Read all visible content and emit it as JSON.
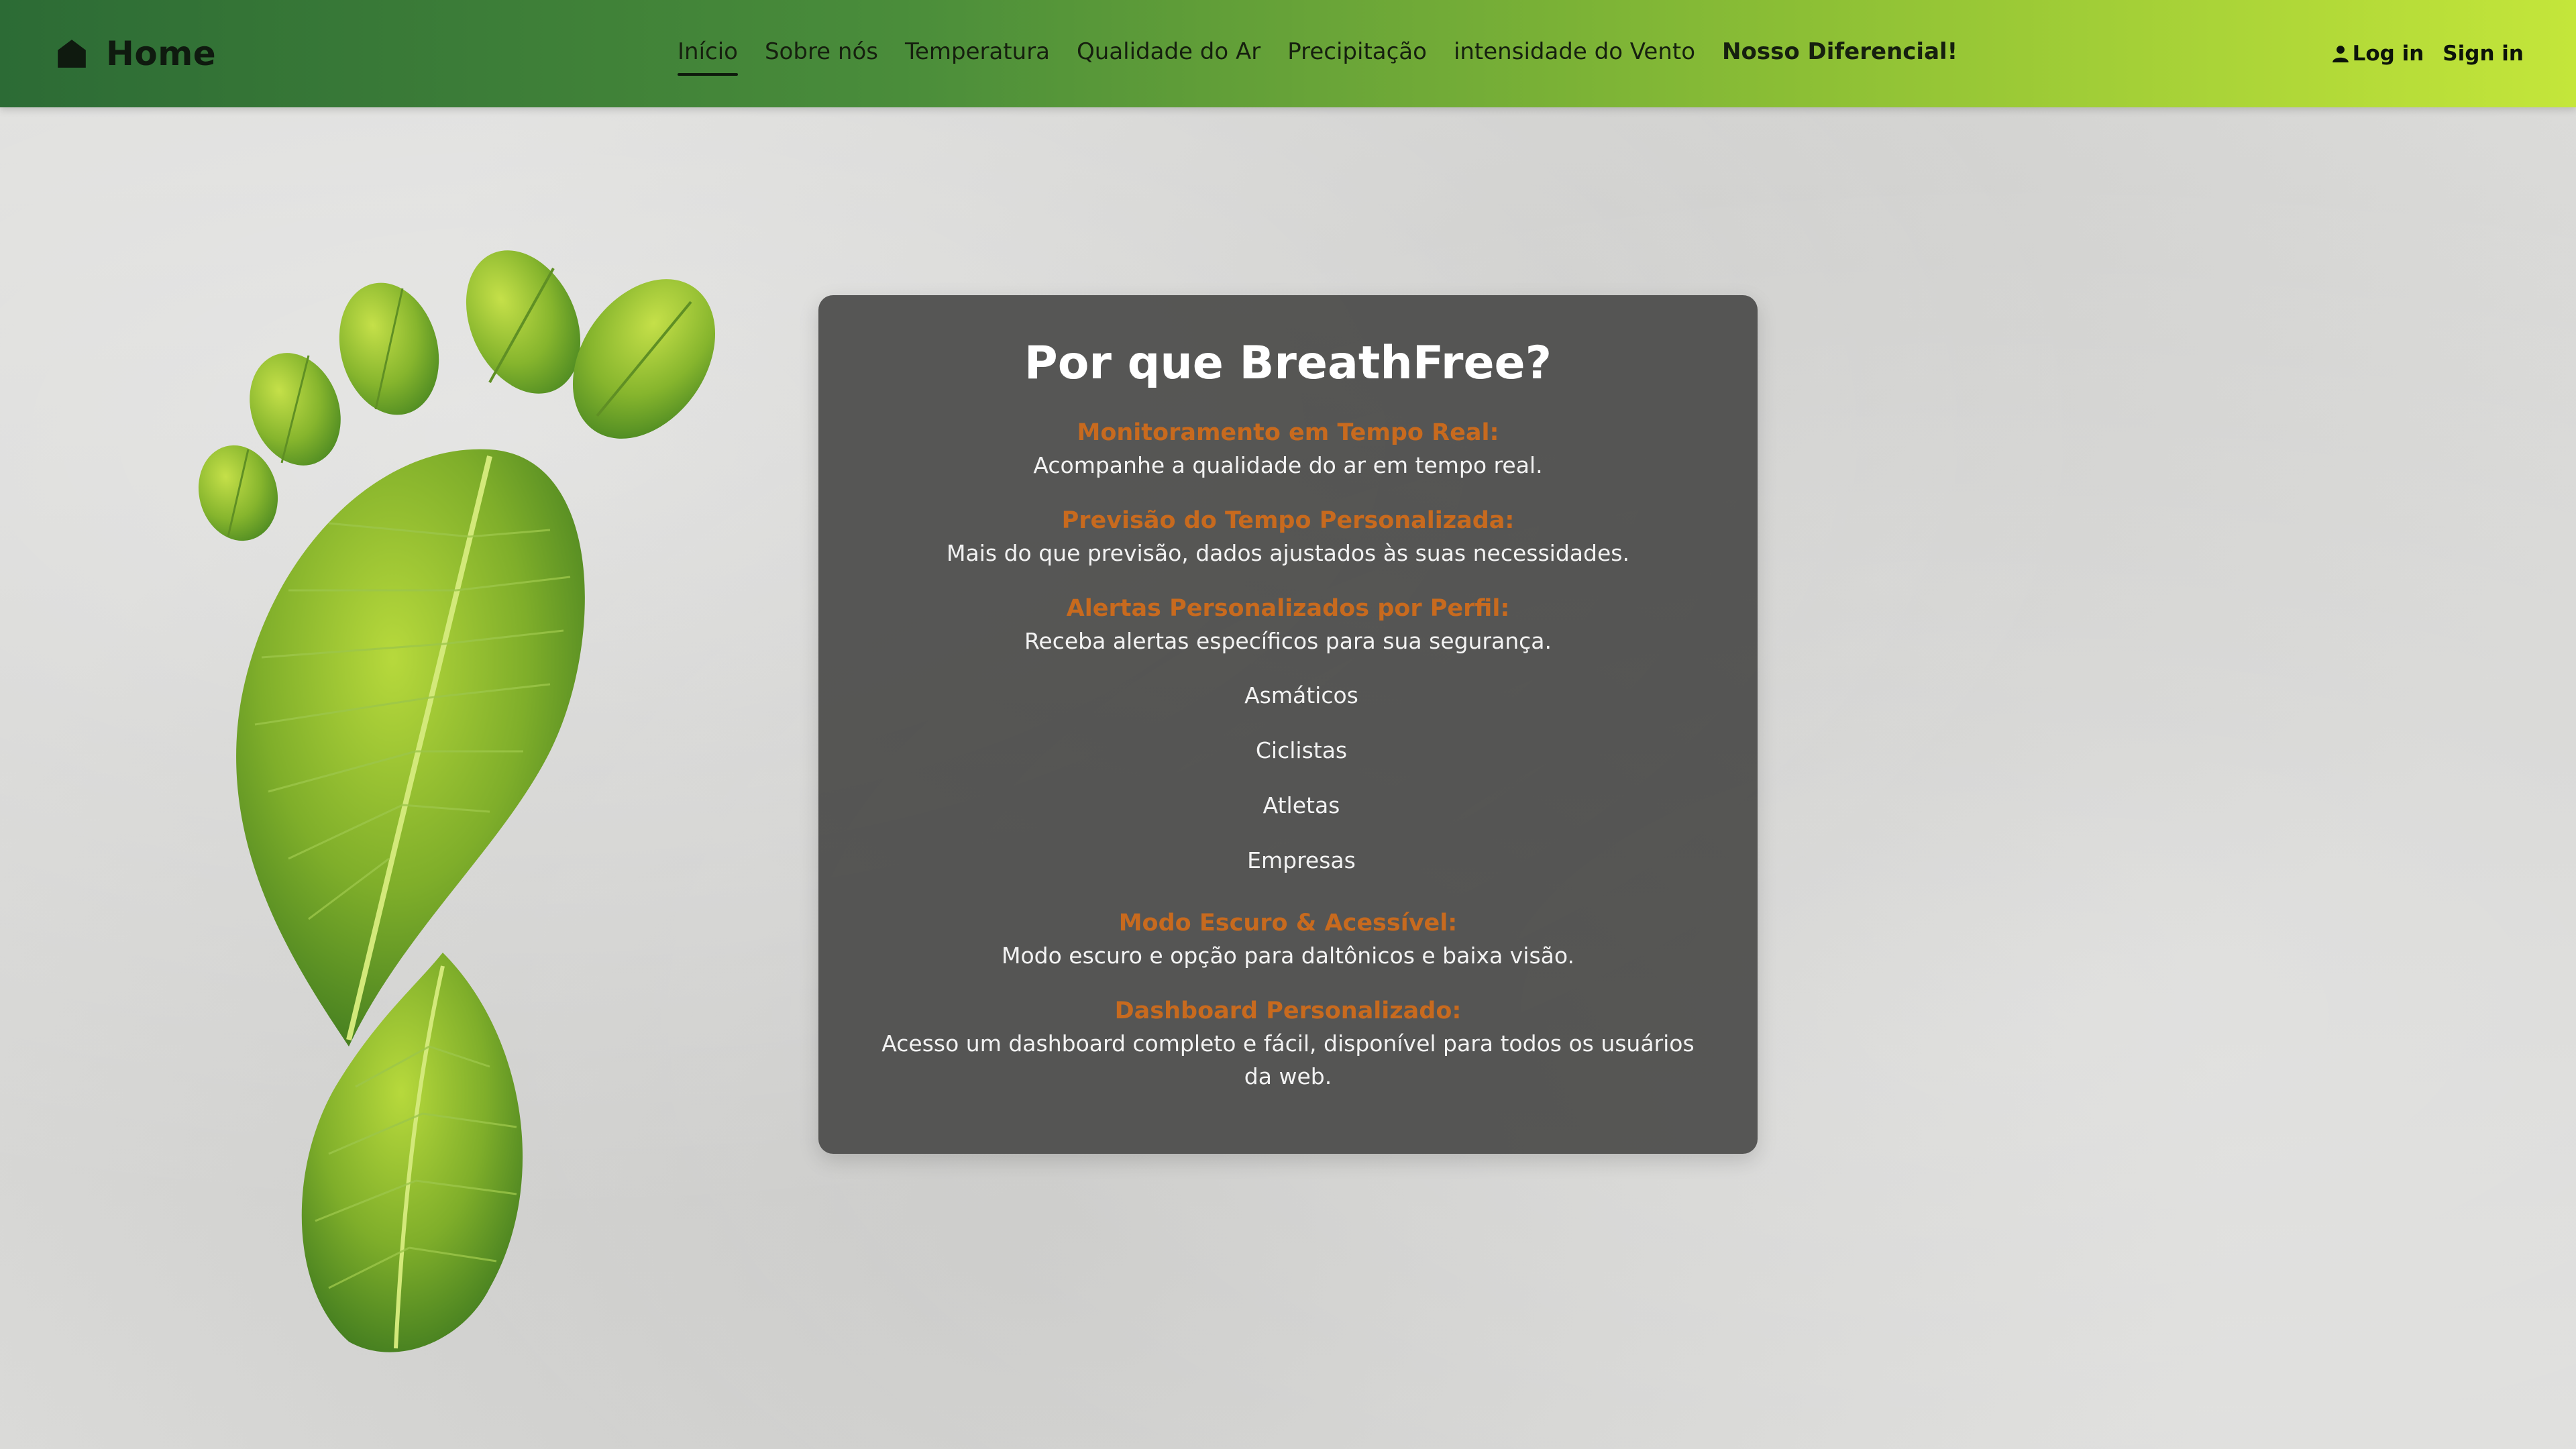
{
  "brand": {
    "label": "Home",
    "icon": "house-icon"
  },
  "nav": {
    "links": [
      {
        "label": "Início",
        "active": true
      },
      {
        "label": "Sobre nós"
      },
      {
        "label": "Temperatura"
      },
      {
        "label": "Qualidade do Ar"
      },
      {
        "label": "Precipitação"
      },
      {
        "label": "intensidade do Vento"
      },
      {
        "label": "Nosso Diferencial!",
        "emphasis": true
      }
    ]
  },
  "auth": {
    "login_label": "Log in",
    "signin_label": "Sign in",
    "login_icon": "user-icon"
  },
  "card": {
    "title": "Por que BreathFree?",
    "features": [
      {
        "title": "Monitoramento em Tempo Real:",
        "desc": "Acompanhe a qualidade do ar em tempo real."
      },
      {
        "title": "Previsão do Tempo Personalizada:",
        "desc": "Mais do que previsão, dados ajustados às suas necessidades."
      },
      {
        "title": "Alertas Personalizados por Perfil:",
        "desc": "Receba alertas específicos para sua segurança."
      },
      {
        "title": "Modo Escuro & Acessível:",
        "desc": "Modo escuro e opção para daltônicos e baixa visão."
      },
      {
        "title": "Dashboard Personalizado:",
        "desc": "Acesso um dashboard completo e fácil, disponível para todos os usuários da web."
      }
    ],
    "profiles": [
      "Asmáticos",
      "Ciclistas",
      "Atletas",
      "Empresas"
    ]
  },
  "colors": {
    "nav_gradient_start": "#2c6b35",
    "nav_gradient_end": "#c4e63a",
    "feature_title": "#c86a1e",
    "card_bg": "#4b4b4a"
  },
  "decor": {
    "image": "leaf-footprint-illustration"
  }
}
